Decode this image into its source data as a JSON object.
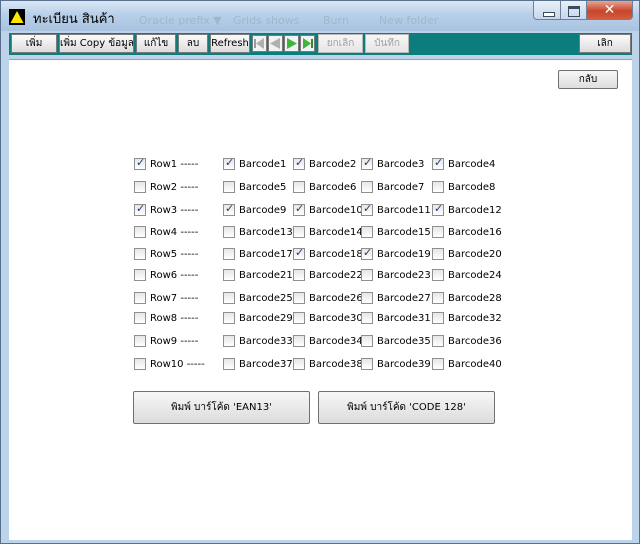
{
  "window": {
    "title": "ทะเบียน สินค้า",
    "ghost_menu": [
      "Oracle prefix ▼",
      "Grids shows",
      "Burn",
      "New folder"
    ]
  },
  "toolbar": {
    "add_label": "เพิ่ม",
    "add_copy_label": "เพิ่ม Copy ข้อมูล",
    "edit_label": "แก้ไข",
    "delete_label": "ลบ",
    "refresh_label": "Refresh",
    "undo_label": "ยกเลิก",
    "save_label": "บันทึก",
    "exit_label": "เลิก"
  },
  "back_label": "กลับ",
  "rows": [
    {
      "label": "Row1 -----",
      "checked": true,
      "barcodes": [
        {
          "label": "Barcode1",
          "checked": true
        },
        {
          "label": "Barcode2",
          "checked": true
        },
        {
          "label": "Barcode3",
          "checked": true
        },
        {
          "label": "Barcode4",
          "checked": true
        }
      ]
    },
    {
      "label": "Row2 -----",
      "checked": false,
      "barcodes": [
        {
          "label": "Barcode5",
          "checked": false
        },
        {
          "label": "Barcode6",
          "checked": false
        },
        {
          "label": "Barcode7",
          "checked": false
        },
        {
          "label": "Barcode8",
          "checked": false
        }
      ]
    },
    {
      "label": "Row3 -----",
      "checked": true,
      "barcodes": [
        {
          "label": "Barcode9",
          "checked": true
        },
        {
          "label": "Barcode10",
          "checked": true
        },
        {
          "label": "Barcode11",
          "checked": true
        },
        {
          "label": "Barcode12",
          "checked": true
        }
      ]
    },
    {
      "label": "Row4 -----",
      "checked": false,
      "barcodes": [
        {
          "label": "Barcode13",
          "checked": false
        },
        {
          "label": "Barcode14",
          "checked": false
        },
        {
          "label": "Barcode15",
          "checked": false
        },
        {
          "label": "Barcode16",
          "checked": false
        }
      ]
    },
    {
      "label": "Row5 -----",
      "checked": false,
      "barcodes": [
        {
          "label": "Barcode17",
          "checked": false
        },
        {
          "label": "Barcode18",
          "checked": true
        },
        {
          "label": "Barcode19",
          "checked": true
        },
        {
          "label": "Barcode20",
          "checked": false
        }
      ]
    },
    {
      "label": "Row6 -----",
      "checked": false,
      "barcodes": [
        {
          "label": "Barcode21",
          "checked": false
        },
        {
          "label": "Barcode22",
          "checked": false
        },
        {
          "label": "Barcode23",
          "checked": false
        },
        {
          "label": "Barcode24",
          "checked": false
        }
      ]
    },
    {
      "label": "Row7 -----",
      "checked": false,
      "barcodes": [
        {
          "label": "Barcode25",
          "checked": false
        },
        {
          "label": "Barcode26",
          "checked": false
        },
        {
          "label": "Barcode27",
          "checked": false
        },
        {
          "label": "Barcode28",
          "checked": false
        }
      ]
    },
    {
      "label": "Row8 -----",
      "checked": false,
      "barcodes": [
        {
          "label": "Barcode29",
          "checked": false
        },
        {
          "label": "Barcode30",
          "checked": false
        },
        {
          "label": "Barcode31",
          "checked": false
        },
        {
          "label": "Barcode32",
          "checked": false
        }
      ]
    },
    {
      "label": "Row9 -----",
      "checked": false,
      "barcodes": [
        {
          "label": "Barcode33",
          "checked": false
        },
        {
          "label": "Barcode34",
          "checked": false
        },
        {
          "label": "Barcode35",
          "checked": false
        },
        {
          "label": "Barcode36",
          "checked": false
        }
      ]
    },
    {
      "label": "Row10 -----",
      "checked": false,
      "barcodes": [
        {
          "label": "Barcode37",
          "checked": false
        },
        {
          "label": "Barcode38",
          "checked": false
        },
        {
          "label": "Barcode39",
          "checked": false
        },
        {
          "label": "Barcode40",
          "checked": false
        }
      ]
    }
  ],
  "print_ean13_label": "พิมพ์ บาร์โค้ด 'EAN13'",
  "print_code128_label": "พิมพ์ บาร์โค้ด 'CODE 128'",
  "colors": {
    "toolbar_bg": "#0d7c7c",
    "check": "#233b7a"
  }
}
